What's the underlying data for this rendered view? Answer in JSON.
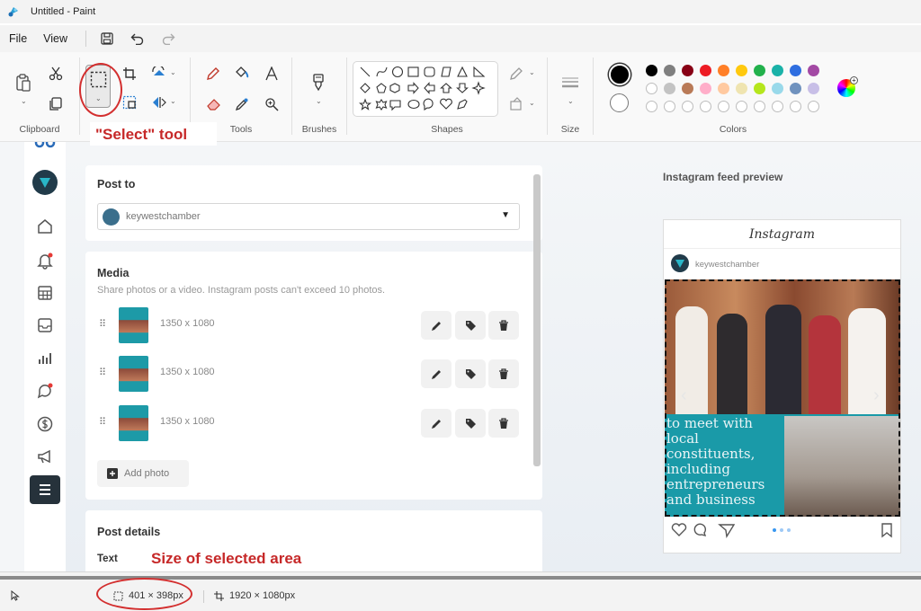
{
  "window": {
    "title": "Untitled - Paint"
  },
  "menu": {
    "file": "File",
    "view": "View"
  },
  "ribbon": {
    "groups": {
      "clipboard": "Clipboard",
      "tools": "Tools",
      "brushes": "Brushes",
      "shapes": "Shapes",
      "size": "Size",
      "colors": "Colors"
    }
  },
  "palette": {
    "row1": [
      "#000000",
      "#7f7f7f",
      "#880015",
      "#ed1c24",
      "#ff7f27",
      "#ffc90e",
      "#22b14c",
      "#1ab2a8",
      "#2f6ee0",
      "#a349a4"
    ],
    "row2": [
      "#ffffff",
      "#c3c3c3",
      "#b97a57",
      "#ffaec9",
      "#ffc9a0",
      "#efe4b0",
      "#b5e61d",
      "#99d9ea",
      "#7092be",
      "#c8bfe7"
    ]
  },
  "annotations": {
    "select_tool": "\"Select\" tool",
    "selected_size": "Size of selected area"
  },
  "canvas_content": {
    "post_to": {
      "title": "Post to",
      "account": "keywestchamber"
    },
    "media": {
      "title": "Media",
      "subtitle": "Share photos or a video. Instagram posts can't exceed 10 photos.",
      "items": [
        {
          "dimensions": "1350 x 1080"
        },
        {
          "dimensions": "1350 x 1080"
        },
        {
          "dimensions": "1350 x 1080"
        }
      ],
      "add_photo": "Add photo"
    },
    "post_details": {
      "title": "Post details",
      "text_label": "Text"
    },
    "preview": {
      "title": "Instagram feed preview",
      "logo": "Instagram",
      "account": "keywestchamber",
      "caption": "to meet with local constituents, including entrepreneurs and business"
    }
  },
  "statusbar": {
    "selection_size": "401 × 398px",
    "canvas_size": "1920 × 1080px"
  }
}
